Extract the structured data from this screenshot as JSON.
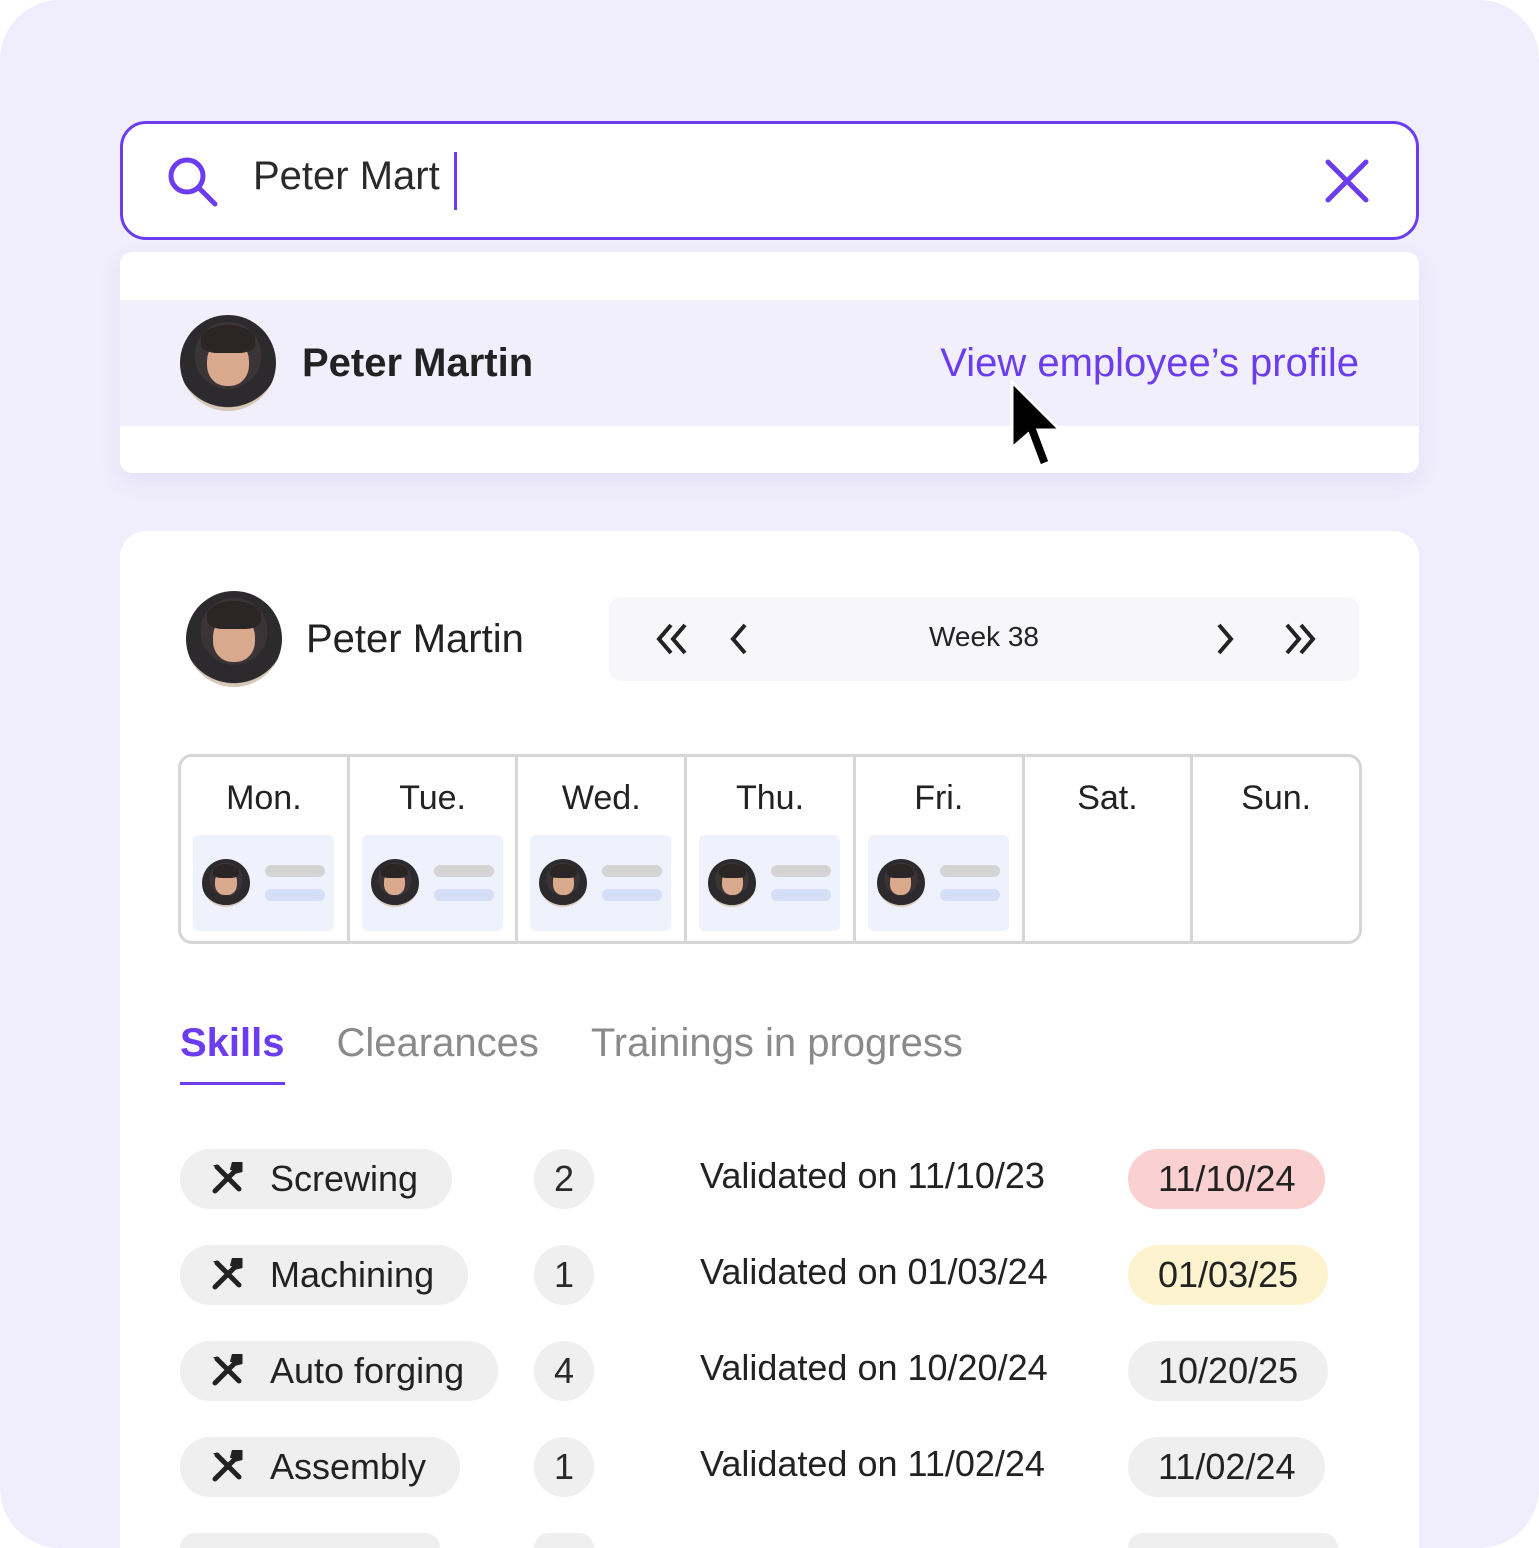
{
  "colors": {
    "accent": "#6b3cf0",
    "background": "#f0eefc",
    "expired": "#fbd0d0",
    "expiring": "#fdf3cf",
    "valid": "#efefef"
  },
  "search": {
    "value": "Peter Mart",
    "icon": "search-icon",
    "clear_icon": "close-icon"
  },
  "dropdown": {
    "results": [
      {
        "name": "Peter Martin",
        "action": "View employee’s profile"
      }
    ]
  },
  "employee": {
    "name": "Peter Martin"
  },
  "week_nav": {
    "label": "Week 38",
    "first": "chevrons-left-icon",
    "prev": "chevron-left-icon",
    "next": "chevron-right-icon",
    "last": "chevrons-right-icon"
  },
  "calendar": {
    "days": [
      {
        "label": "Mon.",
        "has_shift": true
      },
      {
        "label": "Tue.",
        "has_shift": true
      },
      {
        "label": "Wed.",
        "has_shift": true
      },
      {
        "label": "Thu.",
        "has_shift": true
      },
      {
        "label": "Fri.",
        "has_shift": true
      },
      {
        "label": "Sat.",
        "has_shift": false
      },
      {
        "label": "Sun.",
        "has_shift": false
      }
    ]
  },
  "tabs": [
    {
      "label": "Skills",
      "active": true
    },
    {
      "label": "Clearances",
      "active": false
    },
    {
      "label": "Trainings in progress",
      "active": false
    }
  ],
  "skills": [
    {
      "name": "Screwing",
      "level": "2",
      "validated": "Validated on 11/10/23",
      "expiry": "11/10/24",
      "status": "expired"
    },
    {
      "name": "Machining",
      "level": "1",
      "validated": "Validated on 01/03/24",
      "expiry": "01/03/25",
      "status": "expiring"
    },
    {
      "name": "Auto forging",
      "level": "4",
      "validated": "Validated on 10/20/24",
      "expiry": "10/20/25",
      "status": "valid"
    },
    {
      "name": "Assembly",
      "level": "1",
      "validated": "Validated on 11/02/24",
      "expiry": "11/02/24",
      "status": "valid"
    }
  ]
}
